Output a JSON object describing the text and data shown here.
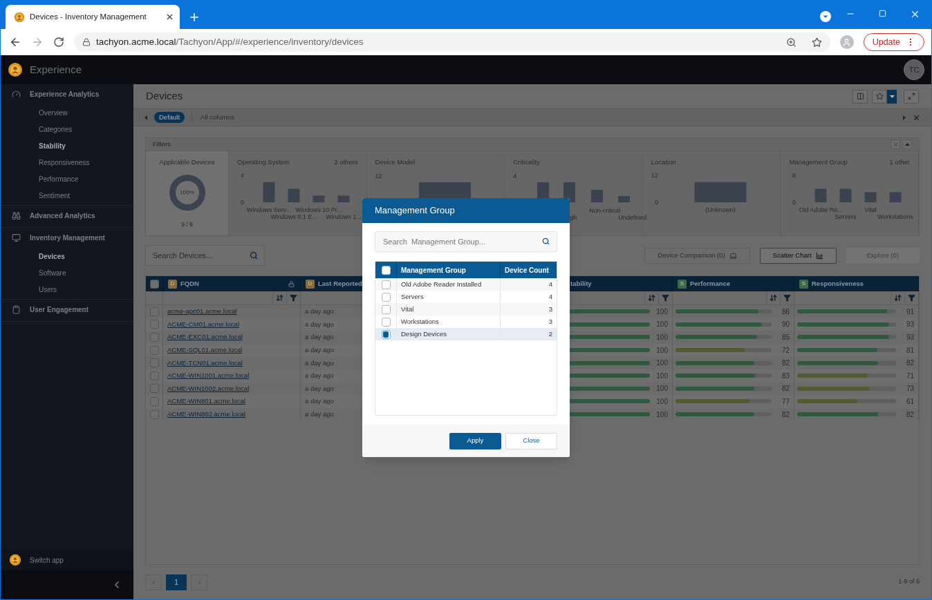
{
  "browser": {
    "tab_title": "Devices - Inventory Management",
    "url_host": "tachyon.acme.local",
    "url_path": "/Tachyon/App/#/experience/inventory/devices",
    "update_button": "Update"
  },
  "app": {
    "name": "Experience",
    "avatar": "TC"
  },
  "sidebar": {
    "sections": [
      {
        "label": "Experience Analytics",
        "kind": "gauge",
        "children": [
          {
            "label": "Overview",
            "selected": false
          },
          {
            "label": "Categories",
            "selected": false
          },
          {
            "label": "Stability",
            "selected": true
          },
          {
            "label": "Responsiveness",
            "selected": false
          },
          {
            "label": "Performance",
            "selected": false
          },
          {
            "label": "Sentiment",
            "selected": false
          }
        ]
      },
      {
        "label": "Advanced Analytics",
        "kind": "binoculars"
      },
      {
        "label": "Inventory Management",
        "kind": "monitor",
        "children": [
          {
            "label": "Devices",
            "selected": true
          },
          {
            "label": "Software",
            "selected": false
          },
          {
            "label": "Users",
            "selected": false
          }
        ]
      },
      {
        "label": "User Engagement",
        "kind": "clipboard"
      }
    ],
    "switch_app": "Switch app"
  },
  "page": {
    "title": "Devices",
    "views": [
      {
        "label": "Default",
        "selected": true
      },
      {
        "label": "All columns",
        "selected": false
      }
    ]
  },
  "filters": {
    "title": "Filters",
    "applicable": {
      "label": "Applicable Devices",
      "percent": "100%",
      "count": "9 / 9"
    },
    "panels": [
      {
        "title": "Operating System",
        "others": "2 others",
        "chart_data": {
          "type": "bar",
          "categories": [
            "Windows Serv...",
            "Windows 8.1 E...",
            "Windows 10 Pr...",
            "Windows 1..."
          ],
          "values": [
            3,
            2,
            1,
            1
          ],
          "ylim": [
            0,
            4
          ],
          "yticks": [
            0,
            4
          ]
        }
      },
      {
        "title": "Device Model",
        "kind": "single_bar_picture",
        "y_max_label": "12"
      },
      {
        "title": "Criticality",
        "kind": "multi_bar_picture",
        "y_max_label": "4",
        "bar_labels": [
          "gh",
          "Non-critical",
          "Undefined"
        ]
      },
      {
        "title": "Location",
        "chart_data": {
          "type": "bar",
          "categories": [
            "(Unknown)"
          ],
          "values": [
            9
          ],
          "ylim": [
            0,
            12
          ],
          "yticks": [
            0,
            12
          ]
        }
      },
      {
        "title": "Management Group",
        "others": "1 other",
        "chart_data": {
          "type": "bar",
          "categories": [
            "Old Adobe Re...",
            "Servers",
            "Vital",
            "Workstations"
          ],
          "values": [
            4,
            4,
            3,
            3
          ],
          "ylim": [
            0,
            8
          ],
          "yticks": [
            0,
            8
          ]
        }
      }
    ]
  },
  "search": {
    "placeholder": "Search Devices..."
  },
  "actions": [
    {
      "label": "Device Comparison (0)",
      "disabled": true,
      "kind": "laptop"
    },
    {
      "label": "Scatter Chart",
      "disabled": false,
      "kind": "chart"
    },
    {
      "label": "Explore (0)",
      "disabled": true,
      "kind": "plain"
    }
  ],
  "table": {
    "all_checked": false,
    "columns": [
      {
        "label": "FQDN",
        "badge": "D",
        "kind": "dimension",
        "locked": true,
        "sortable": true
      },
      {
        "label": "Last Reported",
        "badge": "D",
        "kind": "dimension",
        "locked": false,
        "sortable": false
      },
      {
        "label": "tability",
        "kind": "plain",
        "locked": false,
        "sortable": true
      },
      {
        "label": "Performance",
        "badge": "S",
        "kind": "score",
        "locked": false,
        "sortable": true
      },
      {
        "label": "Responsiveness",
        "badge": "S",
        "kind": "score",
        "locked": false,
        "sortable": true
      }
    ],
    "rows": [
      {
        "checked": false,
        "fqdn": "acme-apc01.acme.local",
        "last_reported": "a day ago",
        "stability": {
          "level": 1,
          "reading": "100"
        },
        "performance": {
          "level": 0.86,
          "reading": "86"
        },
        "responsiveness": {
          "level": 0.91,
          "reading": "91"
        }
      },
      {
        "checked": false,
        "fqdn": "ACME-CM01.acme.local",
        "last_reported": "a day ago",
        "stability": {
          "level": 1,
          "reading": "100"
        },
        "performance": {
          "level": 0.9,
          "reading": "90"
        },
        "responsiveness": {
          "level": 0.93,
          "reading": "93"
        }
      },
      {
        "checked": false,
        "fqdn": "ACME-EXC01.acme.local",
        "last_reported": "a day ago",
        "stability": {
          "level": 1,
          "reading": "100"
        },
        "performance": {
          "level": 0.85,
          "reading": "85"
        },
        "responsiveness": {
          "level": 0.93,
          "reading": "93"
        }
      },
      {
        "checked": false,
        "fqdn": "ACME-SQL01.acme.local",
        "last_reported": "a day ago",
        "stability": {
          "level": 1,
          "reading": "100"
        },
        "performance": {
          "level": 0.72,
          "reading": "72"
        },
        "responsiveness": {
          "level": 0.81,
          "reading": "81"
        }
      },
      {
        "checked": false,
        "fqdn": "ACME-TCN01.acme.local",
        "last_reported": "a day ago",
        "stability": {
          "level": 1,
          "reading": "100"
        },
        "performance": {
          "level": 0.82,
          "reading": "82"
        },
        "responsiveness": {
          "level": 0.82,
          "reading": "82"
        }
      },
      {
        "checked": false,
        "fqdn": "ACME-WIN1001.acme.local",
        "last_reported": "a day ago",
        "stability": {
          "level": 1,
          "reading": "100"
        },
        "performance": {
          "level": 0.83,
          "reading": "83"
        },
        "responsiveness": {
          "level": 0.71,
          "reading": "71"
        }
      },
      {
        "checked": false,
        "fqdn": "ACME-WIN1002.acme.local",
        "last_reported": "a day ago",
        "stability": {
          "level": 1,
          "reading": "100"
        },
        "performance": {
          "level": 0.82,
          "reading": "82"
        },
        "responsiveness": {
          "level": 0.73,
          "reading": "73"
        }
      },
      {
        "checked": false,
        "fqdn": "ACME-WIN801.acme.local",
        "last_reported": "a day ago",
        "stability": {
          "level": 1,
          "reading": "100"
        },
        "performance": {
          "level": 0.77,
          "reading": "77"
        },
        "responsiveness": {
          "level": 0.61,
          "reading": "61"
        }
      },
      {
        "checked": false,
        "fqdn": "ACME-WIN802.acme.local",
        "last_reported": "a day ago",
        "stability": {
          "level": 1,
          "reading": "100"
        },
        "performance": {
          "level": 0.82,
          "reading": "82"
        },
        "responsiveness": {
          "level": 0.82,
          "reading": "82"
        }
      }
    ]
  },
  "pagination": {
    "pages": [
      {
        "label": "1",
        "selected": true
      }
    ],
    "summary": "1-9 of 9"
  },
  "modal": {
    "title": "Management Group",
    "search_placeholder": "Search  Management Group...",
    "all_checked": false,
    "columns": [
      "Management Group",
      "Device Count"
    ],
    "rows": [
      {
        "name": "Old Adobe Reader Installed",
        "count": "4",
        "checked": false
      },
      {
        "name": "Servers",
        "count": "4",
        "checked": false
      },
      {
        "name": "Vital",
        "count": "3",
        "checked": false
      },
      {
        "name": "Workstations",
        "count": "3",
        "checked": false
      },
      {
        "name": "Design Devices",
        "count": "2",
        "checked": true
      }
    ],
    "buttons": [
      "Apply",
      "Close"
    ]
  }
}
